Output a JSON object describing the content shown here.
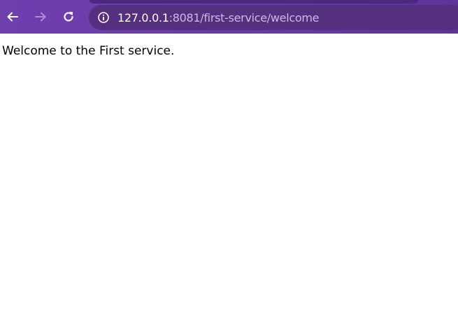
{
  "browser": {
    "url_host": "127.0.0.1",
    "url_rest": ":8081/first-service/welcome",
    "theme_color": "#6f3fae",
    "omnibox_color": "#55307f",
    "icons": {
      "back": "back-arrow-icon",
      "forward": "forward-arrow-icon",
      "reload": "reload-icon",
      "info": "info-icon"
    }
  },
  "page": {
    "body_text": "Welcome to the First service."
  }
}
